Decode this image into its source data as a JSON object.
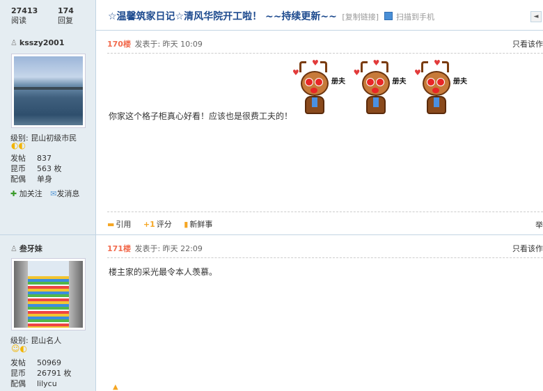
{
  "thread": {
    "views": "27413",
    "views_label": "阅读",
    "replies": "174",
    "replies_label": "回复",
    "title": "☆温馨筑家日记☆清风华院开工啦！ ~~持续更新~~",
    "copy_link": "[复制链接]",
    "scan_label": "扫描到手机",
    "prev_label": "◄"
  },
  "posts": [
    {
      "username": "ksszy2001",
      "level_label": "级别:",
      "level_value": "昆山初级市民",
      "level_badge": "◐◐",
      "info": [
        {
          "k": "发帖",
          "v": "837"
        },
        {
          "k": "昆币",
          "v": "563 枚"
        },
        {
          "k": "配偶",
          "v": "单身"
        }
      ],
      "follow_label": "加关注",
      "message_label": "发消息",
      "floor": "170楼",
      "posted": "发表于: 昨天 10:09",
      "only_author": "只看该作",
      "text": "你家这个格子柜真心好看！应该也是很费工夫的！",
      "emote_text": "册夫",
      "quote_label": "引用",
      "rate_label": "评分",
      "fresh_label": "新鲜事",
      "edge_char": "举"
    },
    {
      "username": "叁牙妹",
      "level_label": "级别:",
      "level_value": "昆山名人",
      "level_badge": "☺◐",
      "info": [
        {
          "k": "发帖",
          "v": "50969"
        },
        {
          "k": "昆币",
          "v": "26791 枚"
        },
        {
          "k": "配偶",
          "v": "lilycu"
        }
      ],
      "floor": "171楼",
      "posted": "发表于: 昨天 22:09",
      "only_author": "只看该作",
      "text": "楼主家的采光最令本人羡慕。"
    }
  ],
  "icons": [
    "user-icon",
    "plus-icon",
    "envelope-icon",
    "quote-icon",
    "rate-icon",
    "fresh-icon",
    "qr-icon",
    "prev-icon"
  ]
}
